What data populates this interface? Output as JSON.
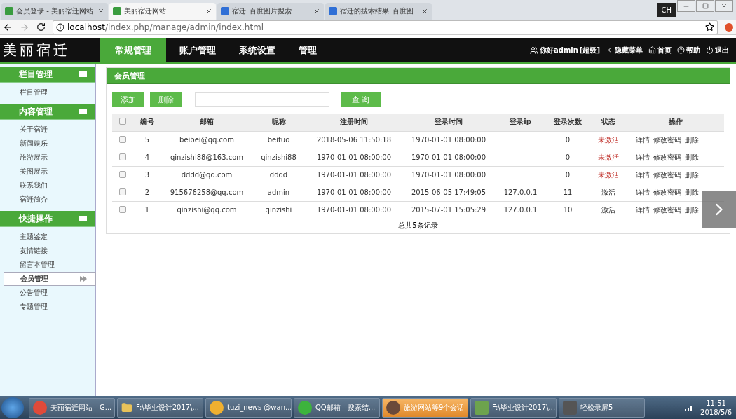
{
  "browser": {
    "tabs": [
      {
        "title": "会员登录 - 美丽宿迁网站",
        "selected": false,
        "kind": "site"
      },
      {
        "title": "美丽宿迁网站",
        "selected": true,
        "kind": "site"
      },
      {
        "title": "宿迁_百度图片搜索",
        "selected": false,
        "kind": "paw"
      },
      {
        "title": "宿迁的搜索结果_百度图",
        "selected": false,
        "kind": "paw"
      }
    ],
    "ime": "CH",
    "url_host": "localhost",
    "url_path": "/index.php/manage/admin/index.html"
  },
  "header": {
    "logo": "美丽宿迁",
    "nav": [
      {
        "label": "常规管理",
        "selected": true
      },
      {
        "label": "账户管理",
        "selected": false
      },
      {
        "label": "系统设置",
        "selected": false
      },
      {
        "label": "管理",
        "selected": false
      }
    ],
    "user": "你好admin",
    "role": "[超级]",
    "links": [
      {
        "kind": "hide",
        "label": "隐藏菜单"
      },
      {
        "kind": "home",
        "label": "首页"
      },
      {
        "kind": "help",
        "label": "帮助"
      },
      {
        "kind": "logout",
        "label": "退出"
      }
    ]
  },
  "sidebar": [
    {
      "title": "栏目管理",
      "items": [
        {
          "label": "栏目管理",
          "selected": false
        }
      ]
    },
    {
      "title": "内容管理",
      "items": [
        {
          "label": "关于宿迁",
          "selected": false
        },
        {
          "label": "新闻娱乐",
          "selected": false
        },
        {
          "label": "旅游展示",
          "selected": false
        },
        {
          "label": "美图展示",
          "selected": false
        },
        {
          "label": "联系我们",
          "selected": false
        },
        {
          "label": "宿迁简介",
          "selected": false
        }
      ]
    },
    {
      "title": "快捷操作",
      "items": [
        {
          "label": "主题鉴定",
          "selected": false
        },
        {
          "label": "友情链接",
          "selected": false
        },
        {
          "label": "留言本管理",
          "selected": false
        },
        {
          "label": "会员管理",
          "selected": true
        },
        {
          "label": "公告管理",
          "selected": false
        },
        {
          "label": "专题管理",
          "selected": false
        }
      ]
    }
  ],
  "panel": {
    "title": "会员管理",
    "buttons": [
      "添加",
      "删除"
    ],
    "search_button": "查 询",
    "table": {
      "all_checked": false,
      "columns": [
        "编号",
        "邮箱",
        "昵称",
        "注册时间",
        "登录时间",
        "登录ip",
        "登录次数",
        "状态",
        "操作"
      ],
      "rows": [
        {
          "id": "5",
          "email": "beibei@qq.com",
          "nick": "beituo",
          "reg": "2018-05-06 11:50:18",
          "login": "1970-01-01 08:00:00",
          "ip": "",
          "count": "0",
          "status": "未激活",
          "activated": false,
          "checked": false,
          "actions": [
            "详情",
            "修改密码",
            "删除"
          ]
        },
        {
          "id": "4",
          "email": "qinzishi88@163.com",
          "nick": "qinzishi88",
          "reg": "1970-01-01 08:00:00",
          "login": "1970-01-01 08:00:00",
          "ip": "",
          "count": "0",
          "status": "未激活",
          "activated": false,
          "checked": false,
          "actions": [
            "详情",
            "修改密码",
            "删除"
          ]
        },
        {
          "id": "3",
          "email": "dddd@qq.com",
          "nick": "dddd",
          "reg": "1970-01-01 08:00:00",
          "login": "1970-01-01 08:00:00",
          "ip": "",
          "count": "0",
          "status": "未激活",
          "activated": false,
          "checked": false,
          "actions": [
            "详情",
            "修改密码",
            "删除"
          ]
        },
        {
          "id": "2",
          "email": "915676258@qq.com",
          "nick": "admin",
          "reg": "1970-01-01 08:00:00",
          "login": "2015-06-05 17:49:05",
          "ip": "127.0.0.1",
          "count": "11",
          "status": "激活",
          "activated": true,
          "checked": false,
          "actions": [
            "详情",
            "修改密码",
            "删除"
          ]
        },
        {
          "id": "1",
          "email": "qinzishi@qq.com",
          "nick": "qinzishi",
          "reg": "1970-01-01 08:00:00",
          "login": "2015-07-01 15:05:29",
          "ip": "127.0.0.1",
          "count": "10",
          "status": "激活",
          "activated": true,
          "checked": false,
          "actions": [
            "详情",
            "修改密码",
            "删除"
          ]
        }
      ],
      "footer": "总共5条记录"
    }
  },
  "taskbar": {
    "items": [
      {
        "kind": "chrome",
        "label": "美丽宿迁网站 - G...",
        "selected": false
      },
      {
        "kind": "folder",
        "label": "F:\\毕业设计2017\\...",
        "selected": false
      },
      {
        "kind": "paw",
        "label": "tuzi_news @wan...",
        "selected": false
      },
      {
        "kind": "ie",
        "label": "QQ邮箱 - 搜索结...",
        "selected": false
      },
      {
        "kind": "avatar",
        "label": "旅游网站等9个会话",
        "selected": true
      },
      {
        "kind": "chart",
        "label": "F:\\毕业设计2017\\...",
        "selected": false
      },
      {
        "kind": "recorder",
        "label": "轻松录屏5",
        "selected": false
      }
    ],
    "time": "11:51",
    "date": "2018/5/6"
  }
}
